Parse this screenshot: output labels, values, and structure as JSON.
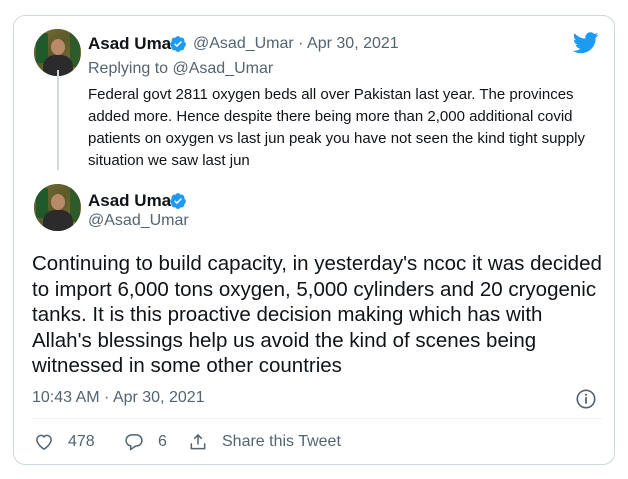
{
  "reply_tweet": {
    "name": "Asad Umar",
    "handle_date": "@Asad_Umar · Apr 30, 2021",
    "replying_to": "Replying to @Asad_Umar",
    "text": "Federal govt 2811 oxygen beds all over Pakistan last year. The provinces added more. Hence despite there being more than 2,000 additional covid patients on oxygen vs last jun peak you have not seen the kind tight supply situation we saw last jun"
  },
  "main_tweet": {
    "name": "Asad Umar",
    "handle": "@Asad_Umar",
    "text": "Continuing to build capacity, in yesterday's ncoc it was decided to import 6,000 tons oxygen, 5,000 cylinders and 20 cryogenic tanks. It is this proactive decision making which has with Allah's blessings help us avoid the kind of scenes being witnessed in some other countries",
    "timestamp": "10:43 AM · Apr 30, 2021"
  },
  "actions": {
    "likes": "478",
    "replies": "6",
    "share_label": "Share this Tweet"
  },
  "colors": {
    "brand": "#1d9bf0",
    "muted": "#536471",
    "border": "#cfd9de"
  },
  "icons": [
    "twitter-bird-icon",
    "verified-badge-icon",
    "heart-icon",
    "reply-icon",
    "share-icon",
    "info-icon"
  ]
}
